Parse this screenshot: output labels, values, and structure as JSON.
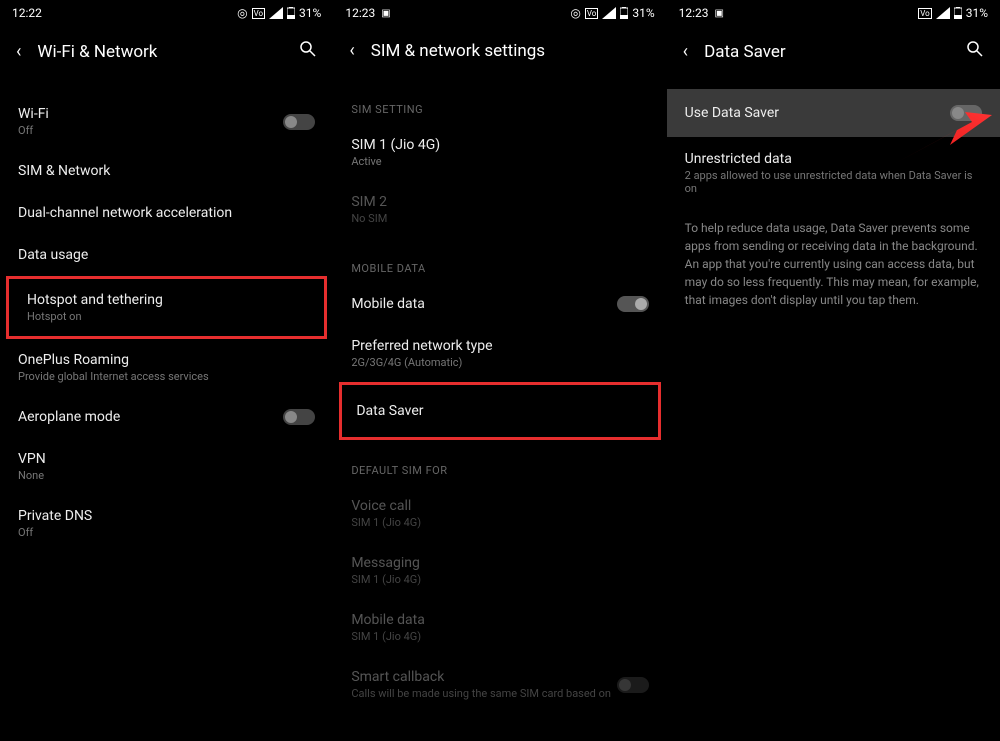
{
  "screen1": {
    "status": {
      "time": "12:22",
      "battery": "31%"
    },
    "header": {
      "title": "Wi-Fi & Network"
    },
    "items": [
      {
        "title": "Wi-Fi",
        "sub": "Off",
        "toggle": false
      },
      {
        "title": "SIM & Network",
        "sub": ""
      },
      {
        "title": "Dual-channel network acceleration",
        "sub": ""
      },
      {
        "title": "Data usage",
        "sub": ""
      },
      {
        "title": "Hotspot and tethering",
        "sub": "Hotspot on"
      },
      {
        "title": "OnePlus Roaming",
        "sub": "Provide global Internet access services"
      },
      {
        "title": "Aeroplane mode",
        "sub": "",
        "toggle": false
      },
      {
        "title": "VPN",
        "sub": "None"
      },
      {
        "title": "Private DNS",
        "sub": "Off"
      }
    ]
  },
  "screen2": {
    "status": {
      "time": "12:23",
      "battery": "31%"
    },
    "header": {
      "title": "SIM & network settings"
    },
    "sections": {
      "sim_setting": "SIM SETTING",
      "mobile_data": "MOBILE DATA",
      "default_sim": "DEFAULT SIM FOR"
    },
    "items": {
      "sim1": {
        "title": "SIM 1 (Jio 4G)",
        "sub": "Active"
      },
      "sim2": {
        "title": "SIM 2",
        "sub": "No SIM"
      },
      "mobile_data": {
        "title": "Mobile data",
        "toggle": true
      },
      "preferred": {
        "title": "Preferred network type",
        "sub": "2G/3G/4G (Automatic)"
      },
      "data_saver": {
        "title": "Data Saver"
      },
      "voice": {
        "title": "Voice call",
        "sub": "SIM 1 (Jio 4G)"
      },
      "messaging": {
        "title": "Messaging",
        "sub": "SIM 1 (Jio 4G)"
      },
      "mobile_data2": {
        "title": "Mobile data",
        "sub": "SIM 1 (Jio 4G)"
      },
      "smart": {
        "title": "Smart callback",
        "sub": "Calls will be made using the same SIM card based on"
      }
    }
  },
  "screen3": {
    "status": {
      "time": "12:23",
      "battery": "31%"
    },
    "header": {
      "title": "Data Saver"
    },
    "use_data_saver": "Use Data Saver",
    "unrestricted": {
      "title": "Unrestricted data",
      "sub": "2 apps allowed to use unrestricted data when Data Saver is on"
    },
    "info": "To help reduce data usage, Data Saver prevents some apps from sending or receiving data in the background. An app that you're currently using can access data, but may do so less frequently. This may mean, for example, that images don't display until you tap them."
  }
}
